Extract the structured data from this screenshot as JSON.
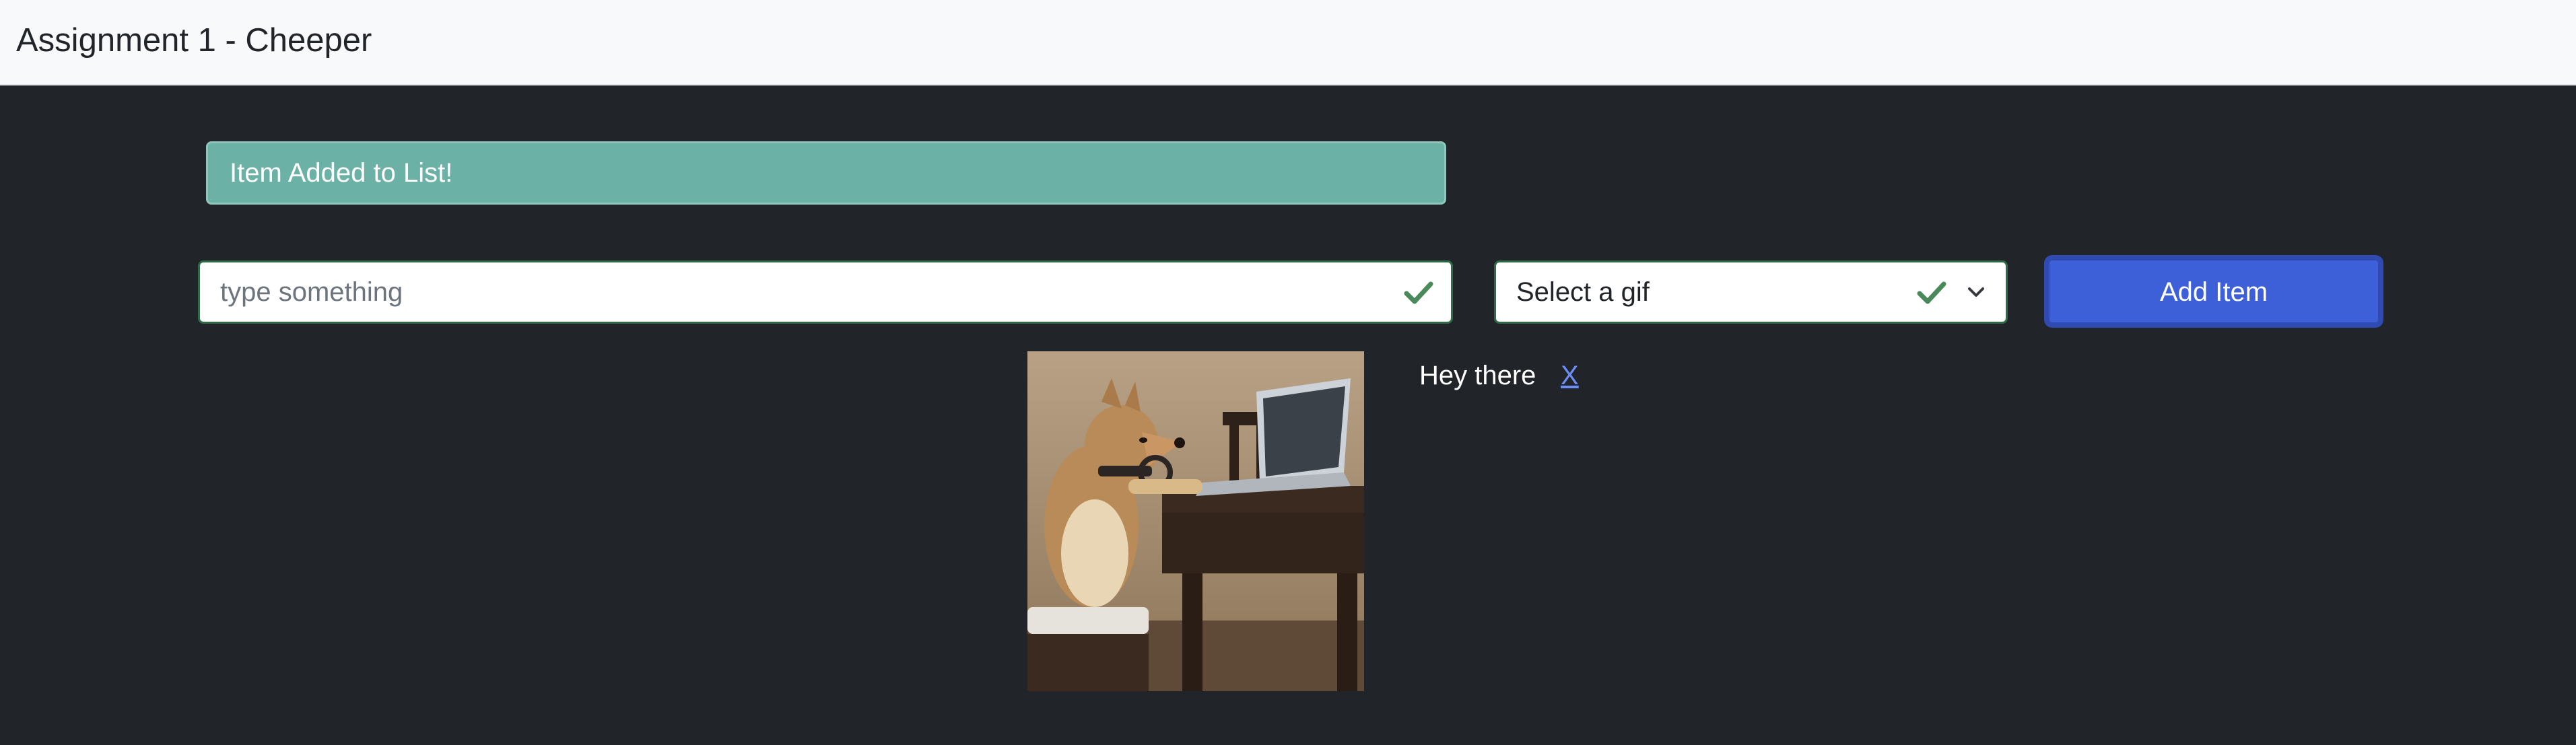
{
  "navbar": {
    "title": "Assignment 1 - Cheeper"
  },
  "alert": {
    "message": "Item Added to List!"
  },
  "form": {
    "text_input": {
      "value": "",
      "placeholder": "type something",
      "valid_icon": "checkmark-icon"
    },
    "gif_select": {
      "selected": "Select a gif",
      "valid_icon": "checkmark-icon",
      "arrow_icon": "chevron-down-icon"
    },
    "add_button_label": "Add Item"
  },
  "items": [
    {
      "gif": "dog at laptop",
      "text": "Hey there",
      "delete_label": "X"
    }
  ],
  "colors": {
    "navbar_bg": "#f8f9fa",
    "page_bg": "#212529",
    "alert_bg": "#6bb1a6",
    "valid_green": "#4a8a5a",
    "button_bg": "#3d5fd8",
    "link": "#6d8ff5"
  }
}
